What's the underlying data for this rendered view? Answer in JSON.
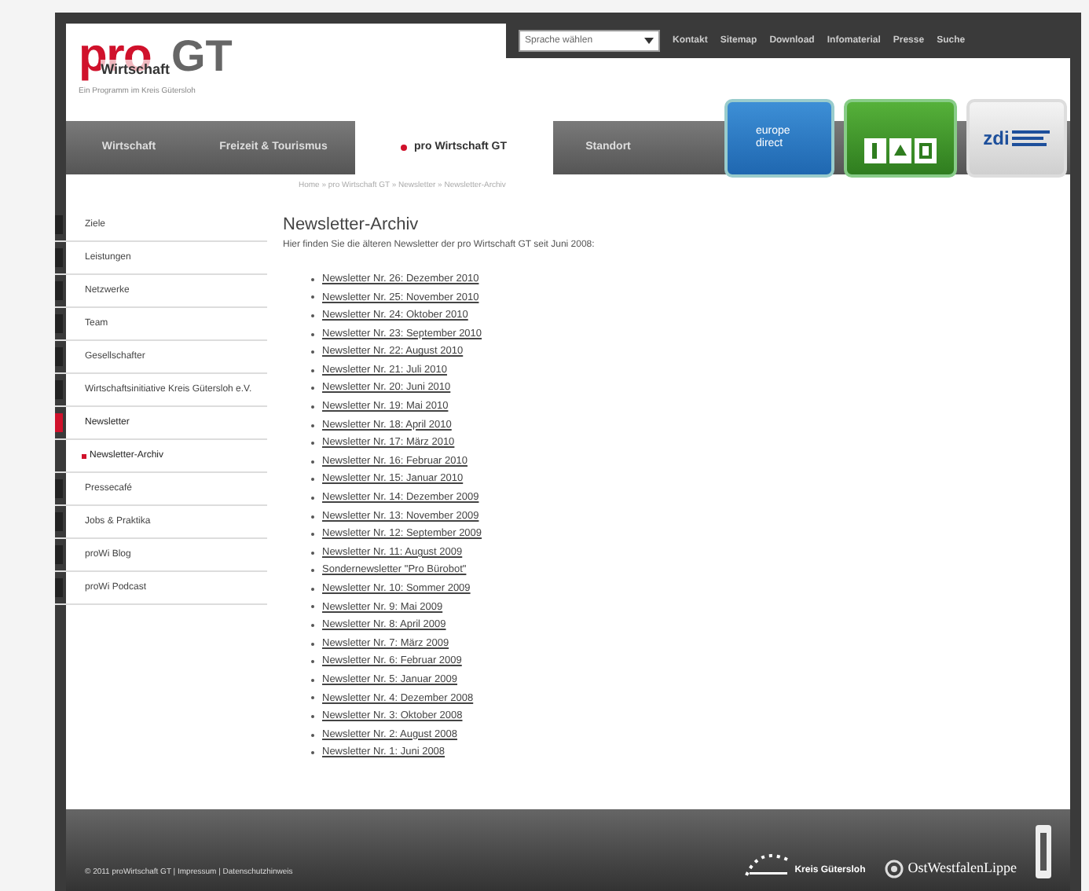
{
  "header": {
    "logo": {
      "top": "pro",
      "middle": "Wirtschaft",
      "right": "GT",
      "tagline": "Ein Programm im Kreis Gütersloh"
    },
    "language_select": {
      "value": "Sprache wählen"
    },
    "top_links": [
      "Kontakt",
      "Sitemap",
      "Download",
      "Infomaterial",
      "Presse",
      "Suche"
    ],
    "tabs": [
      {
        "label": "Wirtschaft",
        "selected": false
      },
      {
        "label": "Freizeit & Tourismus",
        "selected": false
      },
      {
        "label": "pro Wirtschaft GT",
        "selected": true
      },
      {
        "label": "Standort",
        "selected": false
      }
    ],
    "badges": [
      {
        "kind": "europe",
        "text": "europe direct"
      },
      {
        "kind": "green"
      },
      {
        "kind": "zdi",
        "text": "zdi"
      }
    ]
  },
  "sidebar": {
    "items": [
      {
        "label": "Ziele",
        "selected": false
      },
      {
        "label": "Leistungen",
        "selected": false
      },
      {
        "label": "Netzwerke",
        "selected": false
      },
      {
        "label": "Team",
        "selected": false
      },
      {
        "label": "Gesellschafter",
        "selected": false
      },
      {
        "label": "Wirtschaftsinitiative Kreis Gütersloh e.V.",
        "selected": false
      },
      {
        "label": "Newsletter",
        "selected": true,
        "children": [
          {
            "label": "Newsletter-Archiv",
            "selected": true
          }
        ]
      },
      {
        "label": "Pressecafé",
        "selected": false
      },
      {
        "label": "Jobs & Praktika",
        "selected": false
      },
      {
        "label": "proWi Blog",
        "selected": false
      },
      {
        "label": "proWi Podcast",
        "selected": false
      }
    ]
  },
  "breadcrumb": "Home » pro Wirtschaft GT » Newsletter » Newsletter-Archiv",
  "heading": "Newsletter-Archiv",
  "intro": "Hier finden Sie die älteren Newsletter der pro Wirtschaft GT seit Juni 2008:",
  "newsletters": [
    "Newsletter Nr. 26: Dezember 2010",
    "Newsletter Nr. 25: November 2010",
    "Newsletter Nr. 24: Oktober 2010",
    "Newsletter Nr. 23: September 2010",
    "Newsletter Nr. 22: August 2010",
    "Newsletter Nr. 21: Juli 2010",
    "Newsletter Nr. 20: Juni 2010",
    "Newsletter Nr. 19: Mai 2010",
    "Newsletter Nr. 18: April 2010",
    "Newsletter Nr. 17: März 2010",
    "Newsletter Nr. 16: Februar 2010",
    "Newsletter Nr. 15: Januar 2010",
    "Newsletter Nr. 14: Dezember 2009",
    "Newsletter Nr. 13: November 2009",
    "Newsletter Nr. 12: September 2009",
    "Newsletter Nr. 11: August 2009",
    "Sondernewsletter \"Pro Bürobot\"",
    "Newsletter Nr. 10: Sommer 2009",
    "Newsletter Nr. 9: Mai 2009",
    "Newsletter Nr. 8: April 2009",
    "Newsletter Nr. 7: März 2009",
    "Newsletter Nr. 6: Februar 2009",
    "Newsletter Nr. 5: Januar 2009",
    "Newsletter Nr. 4: Dezember 2008",
    "Newsletter Nr. 3: Oktober 2008",
    "Newsletter Nr. 2: August 2008",
    "Newsletter Nr. 1: Juni 2008"
  ],
  "footer": {
    "text": "© 2011 proWirtschaft GT | Impressum | Datenschutzhinweis",
    "logos": [
      "Kreis Gütersloh",
      "OstWestfalenLippe"
    ]
  }
}
